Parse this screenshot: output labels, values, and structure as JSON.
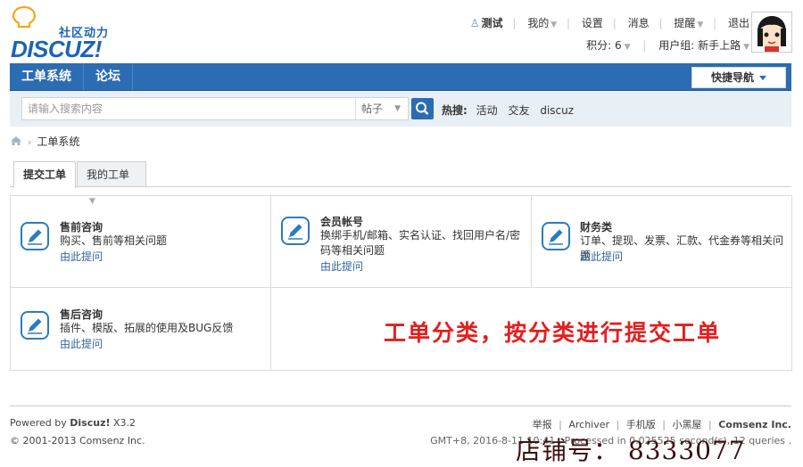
{
  "header": {
    "logo_tagline": "社区动力",
    "logo_brand": "DISCUZ!",
    "user_menu": {
      "username": "测试",
      "my": "我的",
      "settings": "设置",
      "messages": "消息",
      "reminders": "提醒",
      "logout": "退出"
    },
    "points_label": "积分: 6",
    "usergroup_label": "用户组: 新手上路"
  },
  "nav": {
    "items": [
      "工单系统",
      "论坛"
    ],
    "quick_nav": "快捷导航"
  },
  "search": {
    "placeholder": "请输入搜索内容",
    "type_selected": "帖子",
    "hot_label": "热搜:",
    "hot_words": [
      "活动",
      "交友",
      "discuz"
    ]
  },
  "breadcrumb": {
    "current": "工单系统"
  },
  "tabs": {
    "submit": "提交工单",
    "mine": "我的工单"
  },
  "categories": [
    {
      "title": "售前咨询",
      "desc": "购买、售前等相关问题",
      "link": "由此提问"
    },
    {
      "title": "会员帐号",
      "desc": "换绑手机/邮箱、实名认证、找回用户名/密码等相关问题",
      "link": "由此提问"
    },
    {
      "title": "财务类",
      "desc": "订单、提现、发票、汇款、代金券等相关问题",
      "link": "由此提问"
    },
    {
      "title": "售后咨询",
      "desc": "插件、模版、拓展的使用及BUG反馈",
      "link": "由此提问"
    }
  ],
  "annotation": "工单分类，按分类进行提交工单",
  "footer": {
    "powered_prefix": "Powered by",
    "powered_brand": "Discuz!",
    "version": "X3.2",
    "copyright": "© 2001-2013 Comsenz Inc.",
    "links": [
      "举报",
      "Archiver",
      "手机版",
      "小黑屋",
      "Comsenz Inc."
    ],
    "processed": "GMT+8, 2016-8-11 10:41 , Processed in 0.025525 second(s), 12 queries ."
  },
  "watermark": "店铺号： 8333077",
  "colors": {
    "brand_blue": "#2b6cb3",
    "link": "#336699",
    "annotation_red": "#e21f1f"
  }
}
